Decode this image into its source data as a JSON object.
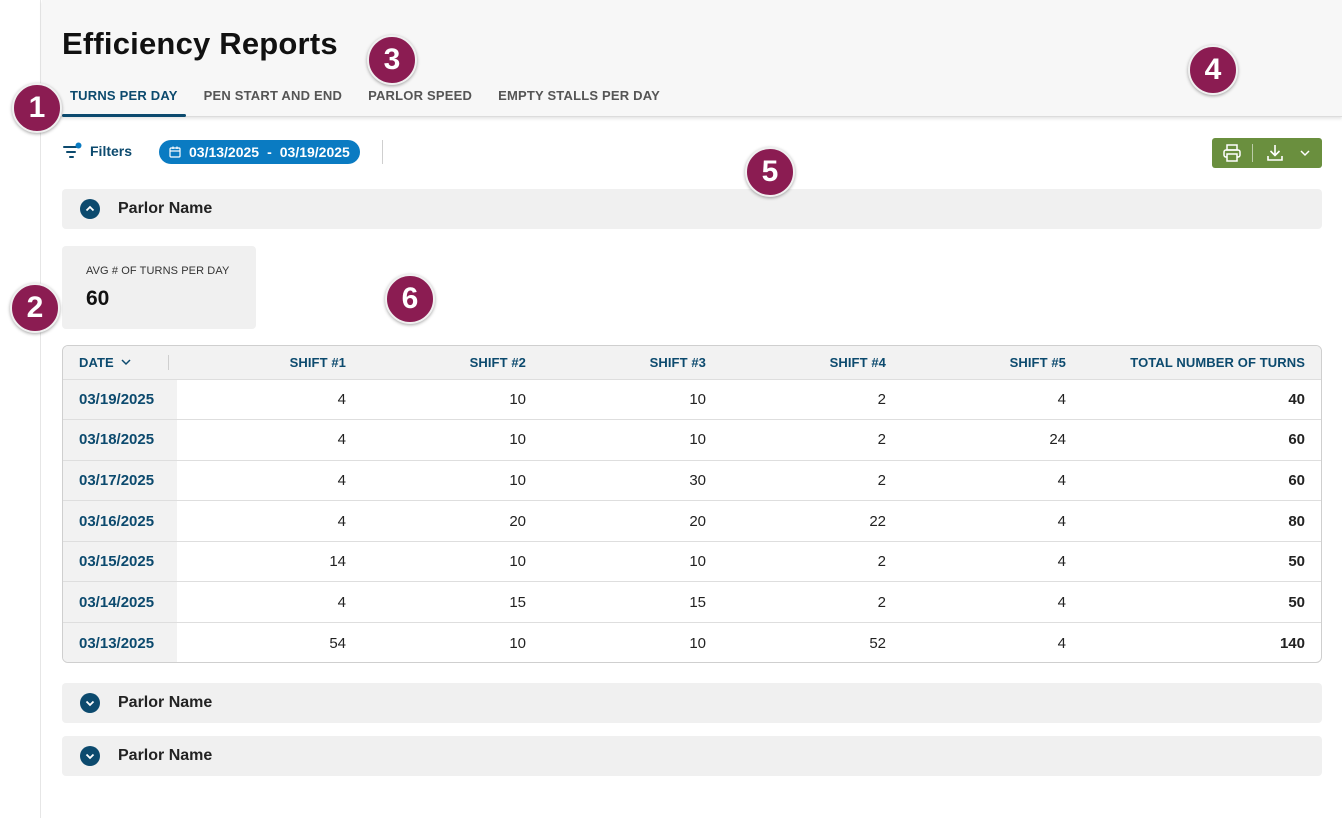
{
  "page": {
    "title": "Efficiency Reports"
  },
  "tabs": [
    {
      "label": "TURNS PER DAY",
      "active": true
    },
    {
      "label": "PEN START AND END",
      "active": false
    },
    {
      "label": "PARLOR SPEED",
      "active": false
    },
    {
      "label": "EMPTY STALLS PER DAY",
      "active": false
    }
  ],
  "toolbar": {
    "filters_label": "Filters",
    "date_start": "03/13/2025",
    "date_sep": "-",
    "date_end": "03/19/2025",
    "print_icon": "printer-icon",
    "download_icon": "download-icon",
    "chevron_icon": "chevron-down-icon"
  },
  "parlor_sections": [
    {
      "name": "Parlor Name",
      "expanded": true
    },
    {
      "name": "Parlor Name",
      "expanded": false
    },
    {
      "name": "Parlor Name",
      "expanded": false
    }
  ],
  "kpi": {
    "label": "AVG # OF TURNS PER DAY",
    "value": "60"
  },
  "table": {
    "columns": [
      "DATE",
      "SHIFT #1",
      "SHIFT #2",
      "SHIFT #3",
      "SHIFT #4",
      "SHIFT #5",
      "TOTAL NUMBER OF TURNS"
    ],
    "rows": [
      {
        "date": "03/19/2025",
        "s1": "4",
        "s2": "10",
        "s3": "10",
        "s4": "2",
        "s5": "4",
        "total": "40"
      },
      {
        "date": "03/18/2025",
        "s1": "4",
        "s2": "10",
        "s3": "10",
        "s4": "2",
        "s5": "24",
        "total": "60"
      },
      {
        "date": "03/17/2025",
        "s1": "4",
        "s2": "10",
        "s3": "30",
        "s4": "2",
        "s5": "4",
        "total": "60"
      },
      {
        "date": "03/16/2025",
        "s1": "4",
        "s2": "20",
        "s3": "20",
        "s4": "22",
        "s5": "4",
        "total": "80"
      },
      {
        "date": "03/15/2025",
        "s1": "14",
        "s2": "10",
        "s3": "10",
        "s4": "2",
        "s5": "4",
        "total": "50"
      },
      {
        "date": "03/14/2025",
        "s1": "4",
        "s2": "15",
        "s3": "15",
        "s4": "2",
        "s5": "4",
        "total": "50"
      },
      {
        "date": "03/13/2025",
        "s1": "54",
        "s2": "10",
        "s3": "10",
        "s4": "52",
        "s5": "4",
        "total": "140"
      }
    ]
  },
  "annotations": [
    "1",
    "2",
    "3",
    "4",
    "5",
    "6"
  ],
  "colors": {
    "accent": "#0c4a6e",
    "chip": "#0a7bc2",
    "export": "#6a8f3e",
    "marker": "#8b1c52"
  }
}
